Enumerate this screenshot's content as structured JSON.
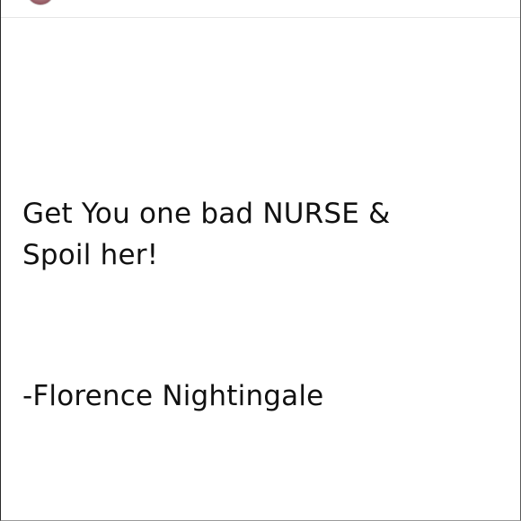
{
  "post": {
    "quote_line1": "Get You one bad NURSE &",
    "quote_line2": "Spoil her!",
    "author": "-Florence Nightingale"
  }
}
